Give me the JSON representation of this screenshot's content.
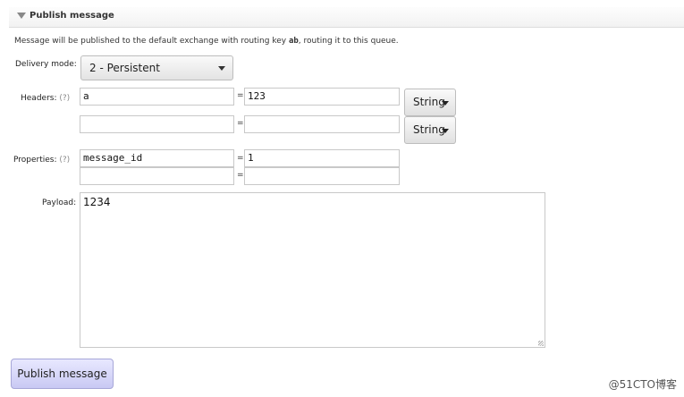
{
  "section": {
    "title": "Publish message"
  },
  "description": {
    "prefix": "Message will be published to the default exchange with routing key ",
    "routing_key": "ab",
    "suffix": ", routing it to this queue."
  },
  "delivery_mode": {
    "label": "Delivery mode:",
    "value": "2 - Persistent"
  },
  "headers": {
    "label": "Headers:",
    "help": "(?)",
    "rows": [
      {
        "key": "a",
        "value": "123",
        "type": "String"
      },
      {
        "key": "",
        "value": "",
        "type": "String"
      }
    ]
  },
  "properties": {
    "label": "Properties:",
    "help": "(?)",
    "rows": [
      {
        "key": "message_id",
        "value": "1"
      },
      {
        "key": "",
        "value": ""
      }
    ]
  },
  "payload": {
    "label": "Payload:",
    "value": "1234"
  },
  "equals_sign": "=",
  "publish_button": {
    "label": "Publish message"
  },
  "watermark": "@51CTO博客",
  "icons": {
    "collapse": "triangle-down-icon",
    "dropdown": "caret-down-icon",
    "resize": "resize-grip-icon"
  }
}
